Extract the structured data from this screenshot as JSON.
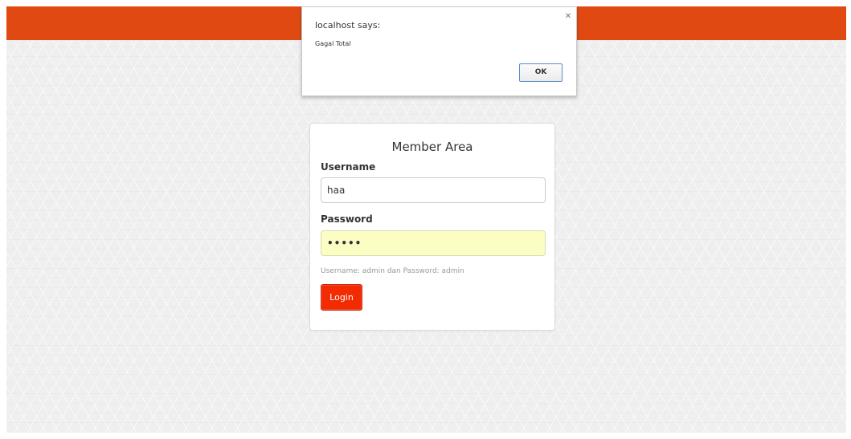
{
  "header": {
    "accent_color": "#e04a12"
  },
  "login": {
    "title": "Member Area",
    "username_label": "Username",
    "username_value": "haa",
    "password_label": "Password",
    "password_masked": "•••••",
    "hint": "Username: admin dan Password: admin",
    "login_button_label": "Login",
    "button_color": "#f22b00"
  },
  "alert": {
    "title": "localhost says:",
    "message": "Gagal Total",
    "ok_label": "OK",
    "close_icon": "close-icon"
  }
}
